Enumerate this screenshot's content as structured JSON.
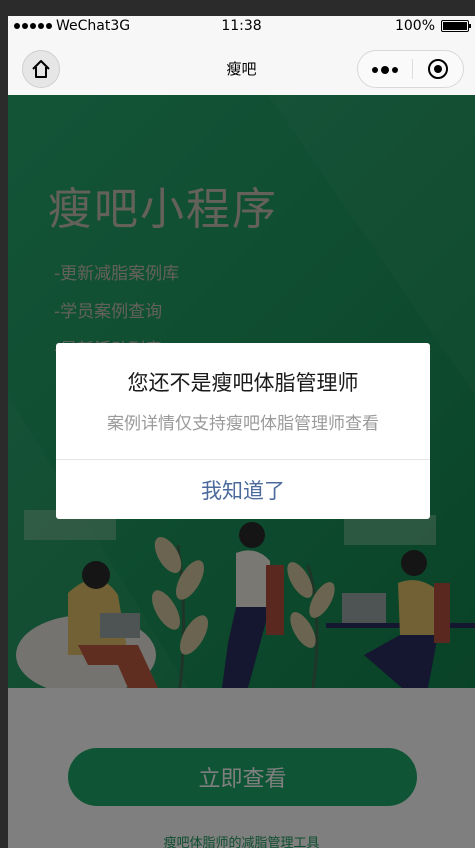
{
  "statusbar": {
    "carrier": "WeChat3G",
    "time": "11:38",
    "battery": "100%"
  },
  "navbar": {
    "title": "瘦吧"
  },
  "banner": {
    "title": "瘦吧小程序",
    "features": [
      "-更新减脂案例库",
      "-学员案例查询",
      "-最新活动列表"
    ]
  },
  "cta": {
    "label": "立即查看"
  },
  "footer": {
    "text": "瘦吧体脂师的减脂管理工具"
  },
  "dialog": {
    "title": "您还不是瘦吧体脂管理师",
    "message": "案例详情仅支持瘦吧体脂管理师查看",
    "button": "我知道了"
  },
  "colors": {
    "brand": "#1eab6b",
    "dialog_button": "#4c6b9c"
  }
}
